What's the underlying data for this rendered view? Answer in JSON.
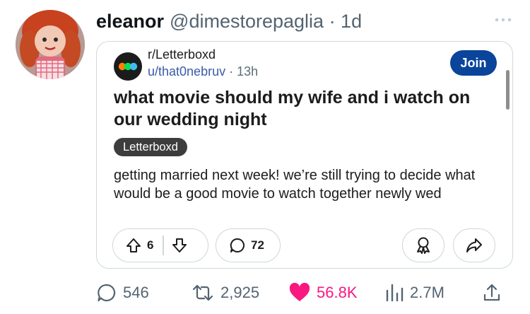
{
  "tweet": {
    "display_name": "eleanor",
    "handle_time": "@dimestorepaglia · 1d"
  },
  "reddit_card": {
    "subreddit": "r/Letterboxd",
    "author": "u/that0nebruv",
    "time": "· 13h",
    "join_label": "Join",
    "title": "what movie should my wife and i watch on our wedding night",
    "flair": "Letterboxd",
    "body": "getting married next week! we’re still trying to decide what would be a good movie to watch together newly wed",
    "votes": "6",
    "comments": "72"
  },
  "actions": {
    "replies": "546",
    "retweets": "2,925",
    "likes": "56.8K",
    "views": "2.7M"
  },
  "colors": {
    "like": "#f91880",
    "join_button": "#0a449b",
    "muted_text": "#536471"
  }
}
